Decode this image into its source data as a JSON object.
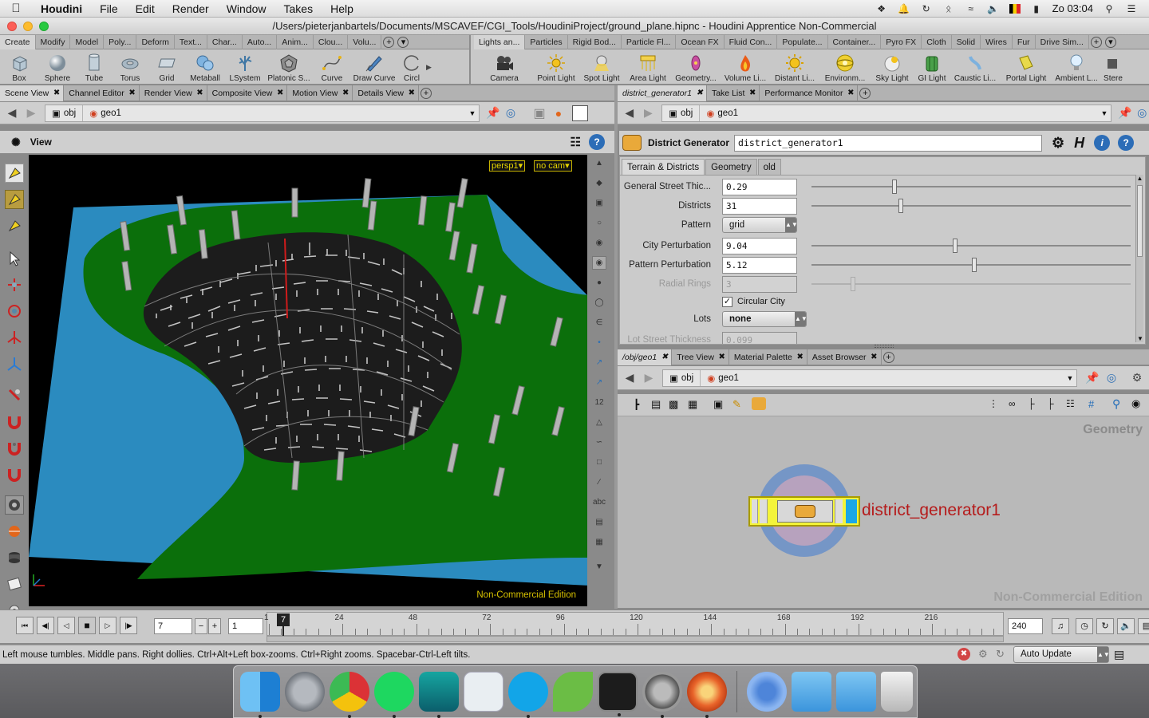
{
  "mac_menu": {
    "apple": "",
    "app": "Houdini",
    "items": [
      "File",
      "Edit",
      "Render",
      "Window",
      "Takes",
      "Help"
    ],
    "clock": "Zo 03:04"
  },
  "window_title": "/Users/pieterjanbartels/Documents/MSCAVEF/CGI_Tools/HoudiniProject/ground_plane.hipnc - Houdini Apprentice Non-Commercial",
  "shelf_left": {
    "tabs": [
      "Create",
      "Modify",
      "Model",
      "Poly...",
      "Deform",
      "Text...",
      "Char...",
      "Auto...",
      "Anim...",
      "Clou...",
      "Volu..."
    ],
    "tools": [
      "Box",
      "Sphere",
      "Tube",
      "Torus",
      "Grid",
      "Metaball",
      "LSystem",
      "Platonic S...",
      "Curve",
      "Draw Curve",
      "Circl"
    ]
  },
  "shelf_right": {
    "tabs": [
      "Lights an...",
      "Particles",
      "Rigid Bod...",
      "Particle Fl...",
      "Ocean FX",
      "Fluid Con...",
      "Populate...",
      "Container...",
      "Pyro FX",
      "Cloth",
      "Solid",
      "Wires",
      "Fur",
      "Drive Sim..."
    ],
    "tools": [
      "Camera",
      "Point Light",
      "Spot Light",
      "Area Light",
      "Geometry...",
      "Volume Li...",
      "Distant Li...",
      "Environm...",
      "Sky Light",
      "GI Light",
      "Caustic Li...",
      "Portal Light",
      "Ambient L...",
      "Stere"
    ]
  },
  "left_pane": {
    "tabs": [
      "Scene View",
      "Channel Editor",
      "Render View",
      "Composite View",
      "Motion View",
      "Details View"
    ],
    "path": [
      "obj",
      "geo1"
    ],
    "view_label": "View",
    "cam_persp": "persp1▾",
    "cam_nocam": "no cam▾",
    "edition": "Non-Commercial Edition"
  },
  "param_pane": {
    "tabs": [
      "district_generator1",
      "Take List",
      "Performance Monitor"
    ],
    "path": [
      "obj",
      "geo1"
    ],
    "node_type": "District Generator",
    "node_name": "district_generator1",
    "subtabs": [
      "Terrain & Districts",
      "Geometry",
      "old"
    ],
    "params": [
      {
        "label": "General Street Thic...",
        "value": "0.29",
        "slider": 0.26
      },
      {
        "label": "Districts",
        "value": "31",
        "slider": 0.28
      },
      {
        "label": "Pattern",
        "value": "grid"
      },
      {
        "label": "City Perturbation",
        "value": "9.04",
        "slider": 0.45
      },
      {
        "label": "Pattern Perturbation",
        "value": "5.12",
        "slider": 0.51
      },
      {
        "label": "Radial Rings",
        "value": "3",
        "slider": 0.13
      },
      {
        "label": "Circular City",
        "value": "Circular City"
      },
      {
        "label": "Lots",
        "value": "none"
      },
      {
        "label": "Lot Street Thickness",
        "value": "0.099"
      }
    ]
  },
  "net_pane": {
    "tabs": [
      "/obj/geo1",
      "Tree View",
      "Material Palette",
      "Asset Browser"
    ],
    "path": [
      "obj",
      "geo1"
    ],
    "context": "Geometry",
    "node_label": "district_generator1",
    "edition": "Non-Commercial Edition"
  },
  "timeline": {
    "current_frame": "7",
    "start": "1",
    "end": "240",
    "marker": "7",
    "ticks": [
      "1",
      "24",
      "48",
      "72",
      "96",
      "120",
      "144",
      "168",
      "192",
      "216"
    ]
  },
  "status": {
    "message": "Left mouse tumbles. Middle pans. Right dollies. Ctrl+Alt+Left box-zooms. Ctrl+Right zooms. Spacebar-Ctrl-Left tilts.",
    "update_mode": "Auto Update"
  },
  "dock": [
    "Finder",
    "Launchpad",
    "Chrome",
    "Spotify",
    "Maya",
    "Preview",
    "Skype",
    "Evernote",
    "Terminal",
    "System Preferences",
    "Houdini",
    "Chrome Canary",
    "Documents",
    "Applications",
    "Trash"
  ]
}
